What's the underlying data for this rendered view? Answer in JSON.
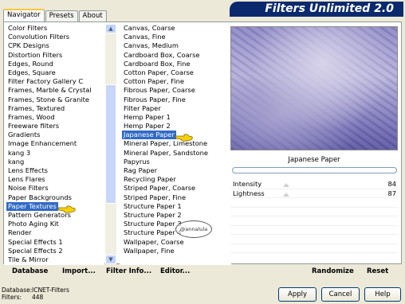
{
  "tabs": [
    "Navigator",
    "Presets",
    "About"
  ],
  "app_title": "Filters Unlimited 2.0",
  "categories": [
    "Color Filters",
    "Convolution Filters",
    "CPK Designs",
    "Distortion Filters",
    "Edges, Round",
    "Edges, Square",
    "Filter Factory Gallery C",
    "Frames, Marble & Crystal",
    "Frames, Stone & Granite",
    "Frames, Textured",
    "Frames, Wood",
    "Freeware filters",
    "Gradients",
    "Image Enhancement",
    "kang 3",
    "kang",
    "Lens Effects",
    "Lens Flares",
    "Noise Filters",
    "Paper Backgrounds",
    "Paper Textures",
    "Pattern Generators",
    "Photo Aging Kit",
    "Render",
    "Special Effects 1",
    "Special Effects 2",
    "Tile & Mirror"
  ],
  "filters": [
    "Canvas, Coarse",
    "Canvas, Fine",
    "Canvas, Medium",
    "Cardboard Box, Coarse",
    "Cardboard Box, Fine",
    "Cotton Paper, Coarse",
    "Cotton Paper, Fine",
    "Fibrous Paper, Coarse",
    "Fibrous Paper, Fine",
    "Filter Paper",
    "Hemp Paper 1",
    "Hemp Paper 2",
    "Japanese Paper",
    "Mineral Paper, Limestone",
    "Mineral Paper, Sandstone",
    "Papyrus",
    "Rag Paper",
    "Recycling Paper",
    "Striped Paper, Coarse",
    "Striped Paper, Fine",
    "Structure Paper 1",
    "Structure Paper 2",
    "Structure Paper 3",
    "Structure Paper 4",
    "Wallpaper, Coarse",
    "Wallpaper, Fine"
  ],
  "selected_category": "Paper Textures",
  "selected_filter": "Japanese Paper",
  "watermark": "@annalula",
  "filter_name": "Japanese Paper",
  "params": [
    {
      "label": "Intensity",
      "value": "84"
    },
    {
      "label": "Lightness",
      "value": "87"
    }
  ],
  "bottom": {
    "database": "Database",
    "import": "Import...",
    "filter_info": "Filter Info...",
    "editor": "Editor...",
    "randomize": "Randomize",
    "reset": "Reset"
  },
  "status": {
    "db_label": "Database:",
    "db_value": "ICNET-Filters",
    "filters_label": "Filters:",
    "filters_value": "448"
  },
  "buttons": {
    "apply": "Apply",
    "cancel": "Cancel",
    "help": "Help"
  },
  "colors": {
    "header": "#0b2a6e",
    "selection": "#316ac5",
    "tab_accent": "#ffc83c"
  }
}
